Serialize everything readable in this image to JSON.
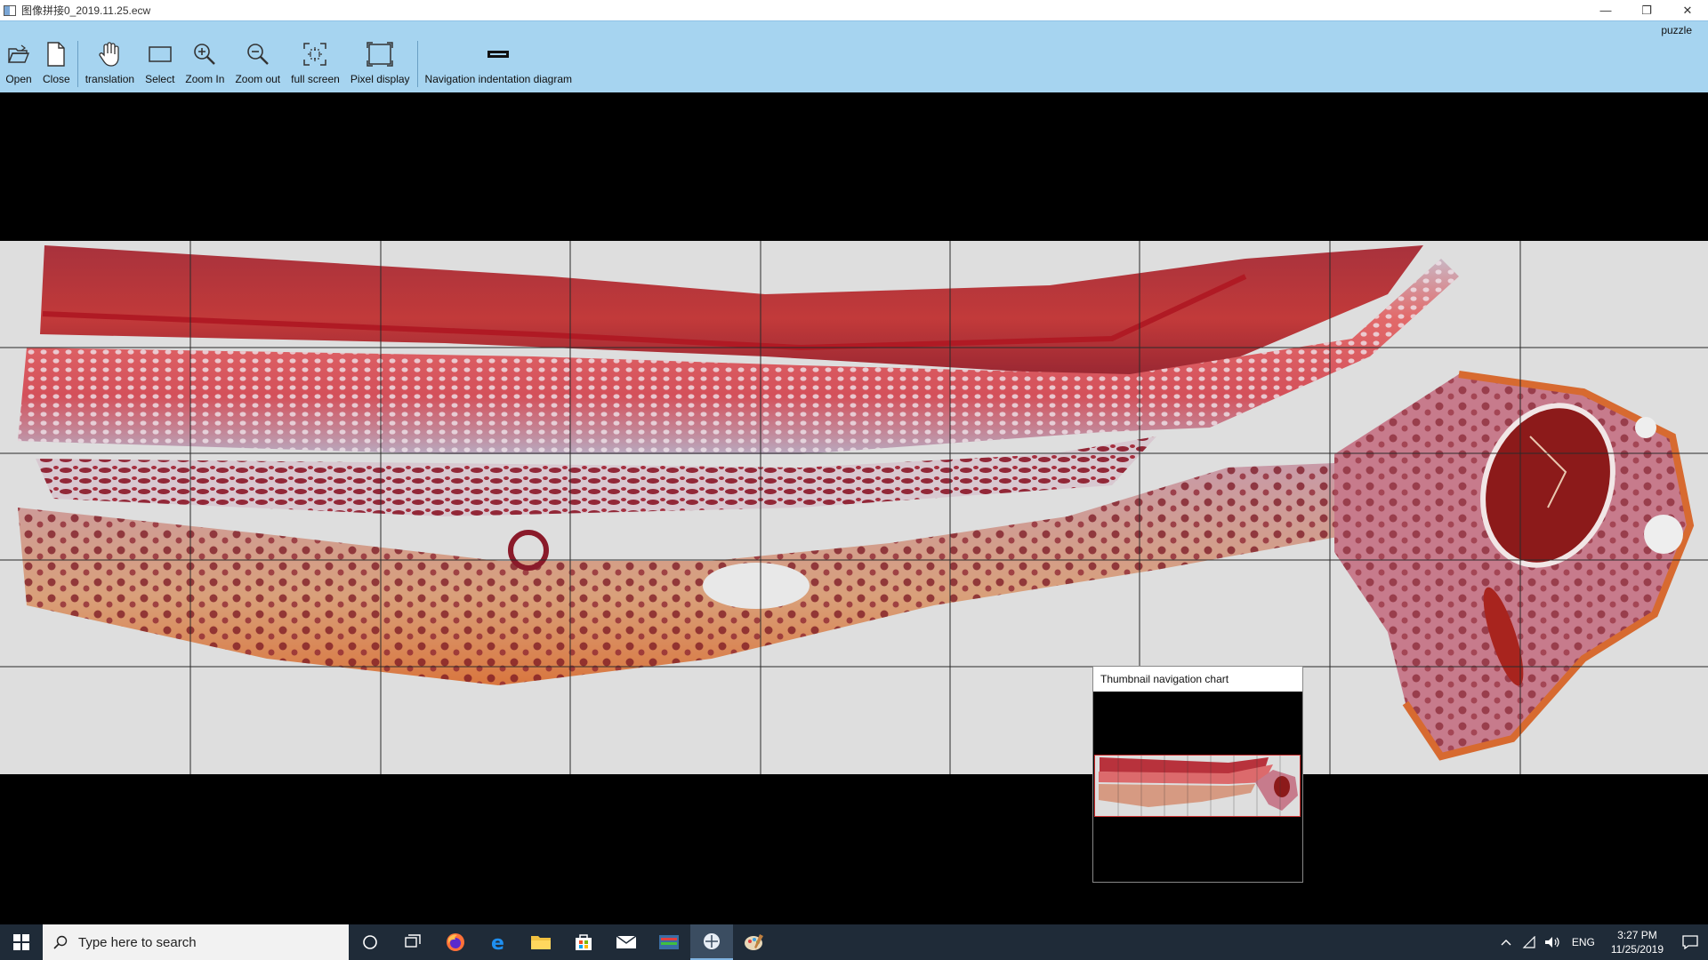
{
  "window": {
    "title": "图像拼接0_2019.11.25.ecw",
    "controls": [
      "—",
      "❐",
      "✕"
    ]
  },
  "ribbon": {
    "tab_label": "puzzle",
    "tools": [
      {
        "id": "open",
        "label": "Open",
        "icon": "open-folder-icon"
      },
      {
        "id": "close",
        "label": "Close",
        "icon": "document-icon"
      },
      {
        "id": "translation",
        "label": "translation",
        "icon": "hand-icon"
      },
      {
        "id": "select",
        "label": "Select",
        "icon": "rectangle-select-icon"
      },
      {
        "id": "zoom-in",
        "label": "Zoom In",
        "icon": "zoom-in-icon"
      },
      {
        "id": "zoom-out",
        "label": "Zoom out",
        "icon": "zoom-out-icon"
      },
      {
        "id": "full-screen",
        "label": "full screen",
        "icon": "full-screen-icon"
      },
      {
        "id": "pixel-display",
        "label": "Pixel display",
        "icon": "pixel-display-icon"
      },
      {
        "id": "navigation",
        "label": "Navigation indentation diagram",
        "icon": "navigation-icon"
      }
    ]
  },
  "thumbnail": {
    "title": "Thumbnail navigation chart"
  },
  "taskbar": {
    "search_placeholder": "Type here to search",
    "apps": [
      "cortana-icon",
      "task-view-icon",
      "firefox-icon",
      "edge-icon",
      "file-explorer-icon",
      "store-icon",
      "mail-icon",
      "media-app-icon",
      "image-viewer-icon",
      "paint-icon"
    ],
    "language": "ENG",
    "time": "3:27 PM",
    "date": "11/25/2019"
  },
  "colors": {
    "ribbon": "#a6d4f0",
    "taskbar": "#1f2b38",
    "tissue_red": "#b8272f",
    "tissue_dark": "#7a1622",
    "tissue_orange": "#d98a5a",
    "background_slide": "#dedede"
  }
}
